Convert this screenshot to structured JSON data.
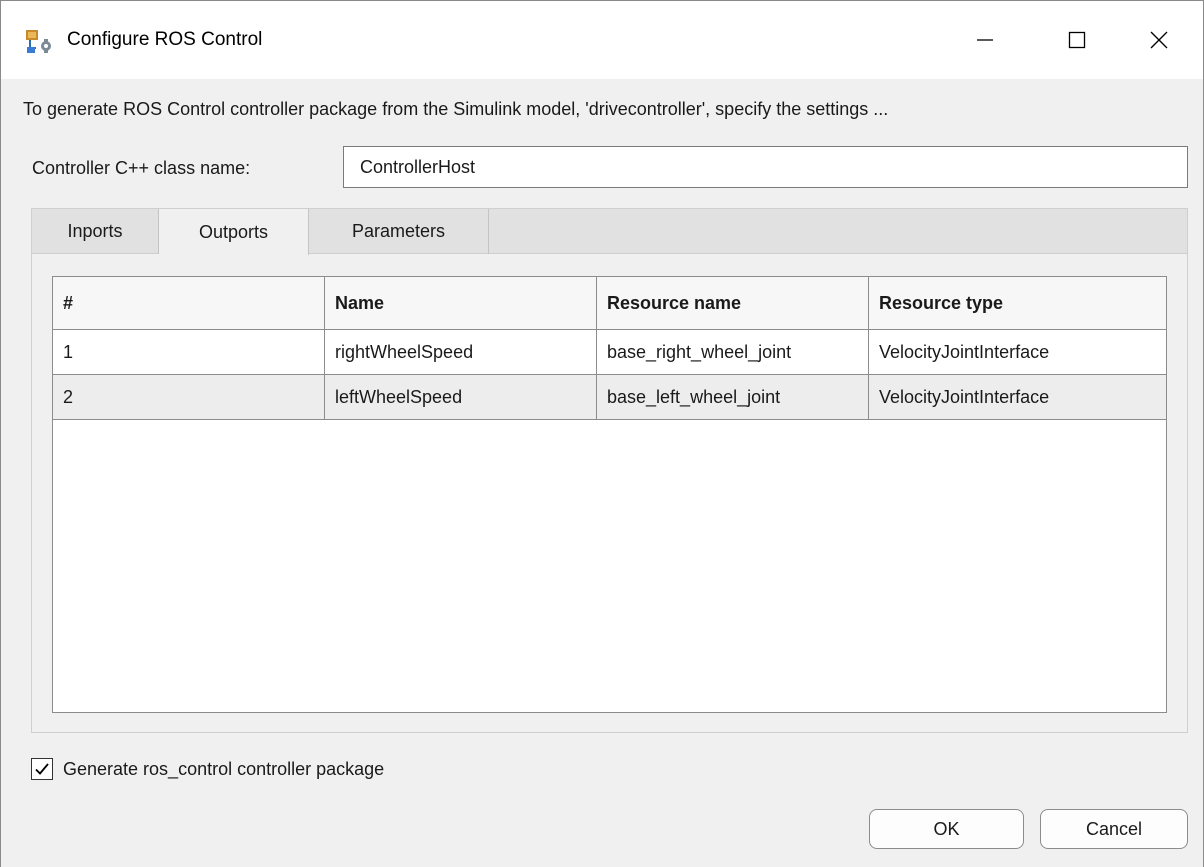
{
  "window": {
    "title": "Configure ROS Control",
    "icon": "simulink-ros-app-icon",
    "controls": {
      "minimize": "minimize-icon",
      "maximize": "maximize-icon",
      "close": "close-icon"
    }
  },
  "description": "To generate ROS Control controller package from the Simulink model, 'drivecontroller', specify the settings ...",
  "class_name": {
    "label": "Controller C++ class name:",
    "value": "ControllerHost"
  },
  "tabs": [
    {
      "label": "Inports",
      "active": false
    },
    {
      "label": "Outports",
      "active": true
    },
    {
      "label": "Parameters",
      "active": false
    }
  ],
  "table": {
    "columns": [
      "#",
      "Name",
      "Resource name",
      "Resource type"
    ],
    "rows": [
      [
        "1",
        "rightWheelSpeed",
        "base_right_wheel_joint",
        "VelocityJointInterface"
      ],
      [
        "2",
        "leftWheelSpeed",
        "base_left_wheel_joint",
        "VelocityJointInterface"
      ]
    ]
  },
  "generate_package": {
    "label": "Generate ros_control controller package",
    "checked": true
  },
  "buttons": {
    "ok": "OK",
    "cancel": "Cancel"
  }
}
